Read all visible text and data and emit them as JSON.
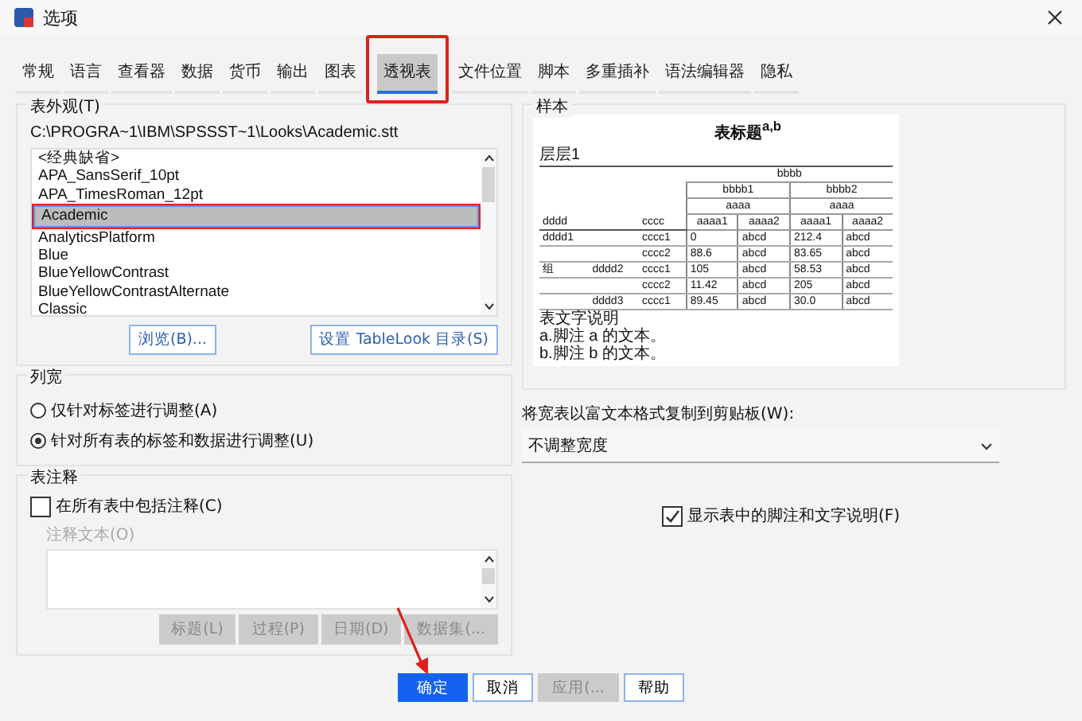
{
  "window": {
    "title": "选项"
  },
  "tabs": [
    {
      "label": "常规",
      "selected": false
    },
    {
      "label": "语言",
      "selected": false
    },
    {
      "label": "查看器",
      "selected": false
    },
    {
      "label": "数据",
      "selected": false
    },
    {
      "label": "货币",
      "selected": false
    },
    {
      "label": "输出",
      "selected": false
    },
    {
      "label": "图表",
      "selected": false
    },
    {
      "label": "透视表",
      "selected": true
    },
    {
      "label": "文件位置",
      "selected": false
    },
    {
      "label": "脚本",
      "selected": false
    },
    {
      "label": "多重插补",
      "selected": false
    },
    {
      "label": "语法编辑器",
      "selected": false
    },
    {
      "label": "隐私",
      "selected": false
    }
  ],
  "table_look": {
    "title": "表外观(T)",
    "path": "C:\\PROGRA~1\\IBM\\SPSSST~1\\Looks\\Academic.stt",
    "items": [
      {
        "label": "<经典缺省>",
        "selected": false
      },
      {
        "label": "APA_SansSerif_10pt",
        "selected": false
      },
      {
        "label": "APA_TimesRoman_12pt",
        "selected": false
      },
      {
        "label": "Academic",
        "selected": true
      },
      {
        "label": "AnalyticsPlatform",
        "selected": false
      },
      {
        "label": "Blue",
        "selected": false
      },
      {
        "label": "BlueYellowContrast",
        "selected": false
      },
      {
        "label": "BlueYellowContrastAlternate",
        "selected": false
      },
      {
        "label": "Classic",
        "selected": false
      }
    ],
    "buttons": [
      "浏览(B)...",
      "设置 TableLook 目录(S)"
    ]
  },
  "sample": {
    "title": "样本",
    "table_title": "表标题$^{a,b}$",
    "layer": "层层1",
    "header_top": "bbbb",
    "header_groups": [
      "bbbb1",
      "bbbb2"
    ],
    "header_sub": [
      "aaaa",
      "aaaa"
    ],
    "header_row": [
      "dddd",
      "cccc",
      "aaaa1",
      "aaaa2",
      "aaaa1",
      "aaaa2"
    ],
    "rows": [
      {
        "cells": [
          "dddd1",
          "",
          "cccc1",
          "0",
          "abcd",
          "212.4",
          "abcd"
        ]
      },
      {
        "cells": [
          "",
          "",
          "cccc2",
          "88.6",
          "abcd",
          "83.65",
          "abcd"
        ]
      },
      {
        "cells": [
          "组",
          "dddd2",
          "cccc1",
          "105",
          "abcd",
          "58.53",
          "abcd"
        ]
      },
      {
        "cells": [
          "",
          "",
          "cccc2",
          "11.42",
          "abcd",
          "205",
          "abcd"
        ]
      },
      {
        "cells": [
          "",
          "dddd3",
          "cccc1",
          "89.45",
          "abcd",
          "30.0",
          "abcd"
        ]
      }
    ],
    "notes": [
      "表文字说明",
      "a.脚注 a 的文本。",
      "b.脚注 b 的文本。"
    ]
  },
  "column_width": {
    "title": "列宽",
    "options": [
      {
        "label": "仅针对标签进行调整(A)",
        "selected": false
      },
      {
        "label": "针对所有表的标签和数据进行调整(U)",
        "selected": true
      }
    ]
  },
  "copy_wide": {
    "label": "将宽表以富文本格式复制到剪贴板(W):",
    "value": "不调整宽度"
  },
  "show_footnotes": {
    "label": "显示表中的脚注和文字说明(F)",
    "checked": true
  },
  "comments": {
    "title": "表注释",
    "include": {
      "label": "在所有表中包括注释(C)",
      "checked": false
    },
    "text_label": "注释文本(O)",
    "buttons": [
      {
        "label": "标题(L)",
        "disabled": true
      },
      {
        "label": "过程(P)",
        "disabled": true
      },
      {
        "label": "日期(D)",
        "disabled": true
      },
      {
        "label": "数据集(...",
        "disabled": true
      }
    ]
  },
  "footer_buttons": [
    {
      "label": "确定",
      "kind": "primary",
      "disabled": false
    },
    {
      "label": "取消",
      "kind": "normal",
      "disabled": false
    },
    {
      "label": "应用(...",
      "kind": "normal",
      "disabled": true
    },
    {
      "label": "帮助",
      "kind": "normal",
      "disabled": false
    }
  ]
}
